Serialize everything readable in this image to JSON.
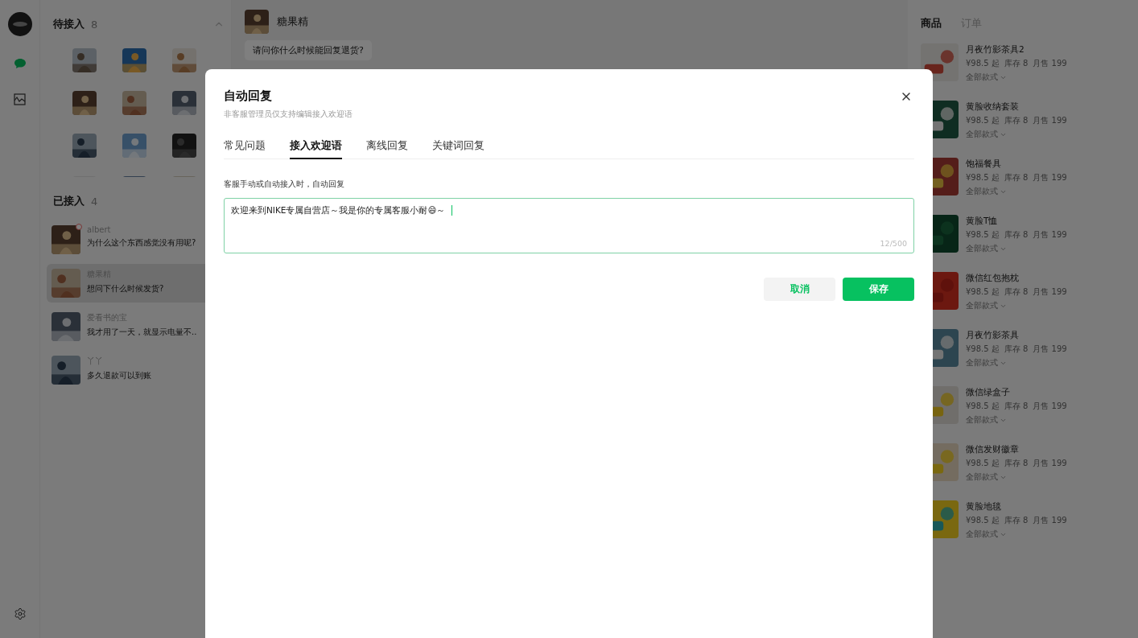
{
  "rail": {
    "items": [
      {
        "kind": "chat",
        "selected": true
      },
      {
        "kind": "chart",
        "selected": false
      }
    ]
  },
  "waiting": {
    "title": "待接入",
    "count": "8"
  },
  "connected": {
    "title": "已接入",
    "count": "4",
    "sessions": [
      {
        "name": "albert",
        "message": "为什么这个东西感觉没有用呢?",
        "selected": false,
        "unread": true
      },
      {
        "name": "糖果精",
        "message": "想问下什么时候发货?",
        "selected": true,
        "unread": false
      },
      {
        "name": "爱看书的宝",
        "message": "我才用了一天，就显示电量不..",
        "selected": false,
        "unread": false
      },
      {
        "name": "丫丫",
        "message": "多久退款可以到账",
        "selected": false,
        "unread": false
      }
    ]
  },
  "chat": {
    "contact": "糖果精",
    "messages": [
      "请问你什么时候能回复退货?"
    ]
  },
  "products": {
    "tabs": [
      {
        "label": "商品",
        "selected": true
      },
      {
        "label": "订单",
        "selected": false
      }
    ],
    "items": [
      {
        "name": "月夜竹影茶具2",
        "price": "¥98.5 起",
        "stock": "库存 8",
        "sales": "月售 199",
        "variant": "全部款式"
      },
      {
        "name": "黄脸收纳套装",
        "price": "¥98.5 起",
        "stock": "库存 8",
        "sales": "月售 199",
        "variant": "全部款式"
      },
      {
        "name": "饱福餐具",
        "price": "¥98.5 起",
        "stock": "库存 8",
        "sales": "月售 199",
        "variant": "全部款式"
      },
      {
        "name": "黄脸T恤",
        "price": "¥98.5 起",
        "stock": "库存 8",
        "sales": "月售 199",
        "variant": "全部款式"
      },
      {
        "name": "微信红包抱枕",
        "price": "¥98.5 起",
        "stock": "库存 8",
        "sales": "月售 199",
        "variant": "全部款式"
      },
      {
        "name": "月夜竹影茶具",
        "price": "¥98.5 起",
        "stock": "库存 8",
        "sales": "月售 199",
        "variant": "全部款式"
      },
      {
        "name": "微信绿盒子",
        "price": "¥98.5 起",
        "stock": "库存 8",
        "sales": "月售 199",
        "variant": "全部款式"
      },
      {
        "name": "微信发财徽章",
        "price": "¥98.5 起",
        "stock": "库存 8",
        "sales": "月售 199",
        "variant": "全部款式"
      },
      {
        "name": "黄脸地毯",
        "price": "¥98.5 起",
        "stock": "库存 8",
        "sales": "月售 199",
        "variant": "全部款式"
      }
    ]
  },
  "dialog": {
    "title": "自动回复",
    "subtitle": "非客服管理员仅支持编辑接入欢迎语",
    "tabs": [
      {
        "label": "常见问题",
        "selected": false
      },
      {
        "label": "接入欢迎语",
        "selected": true
      },
      {
        "label": "离线回复",
        "selected": false
      },
      {
        "label": "关键词回复",
        "selected": false
      }
    ],
    "field_label": "客服手动或自动接入时，自动回复",
    "value": "欢迎来到NIKE专属自营店～我是你的专属客服小耐😄～ ",
    "counter": "12/500",
    "buttons": [
      {
        "kind": "cancel",
        "label": "取消"
      },
      {
        "kind": "save",
        "label": "保存"
      }
    ]
  }
}
